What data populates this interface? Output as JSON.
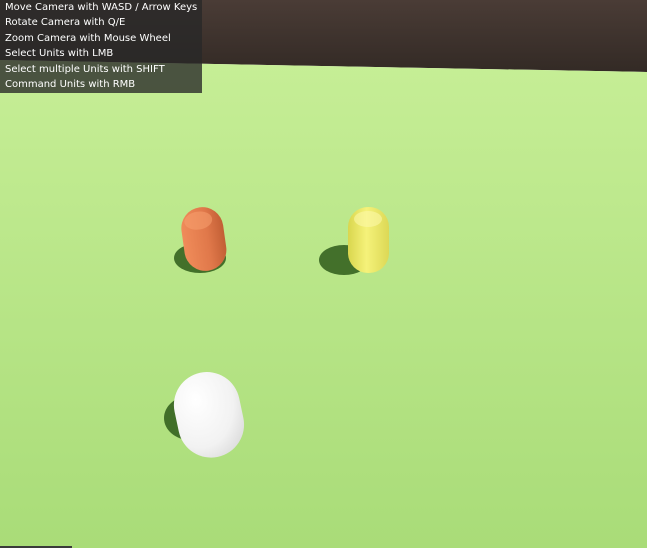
{
  "instructions": [
    "Move Camera with WASD / Arrow Keys",
    "Rotate Camera with Q/E",
    "Zoom Camera with Mouse Wheel",
    "Select Units with LMB",
    "Select multiple Units with SHIFT",
    "Command Units with RMB"
  ],
  "colors": {
    "ground": "#b8e68a",
    "sky": "#3f3530",
    "unit_orange": "#e07a4a",
    "unit_yellow": "#f2ee6a",
    "unit_white": "#f4f4f4"
  },
  "units": [
    {
      "name": "orange-unit"
    },
    {
      "name": "yellow-unit"
    },
    {
      "name": "white-unit"
    }
  ]
}
